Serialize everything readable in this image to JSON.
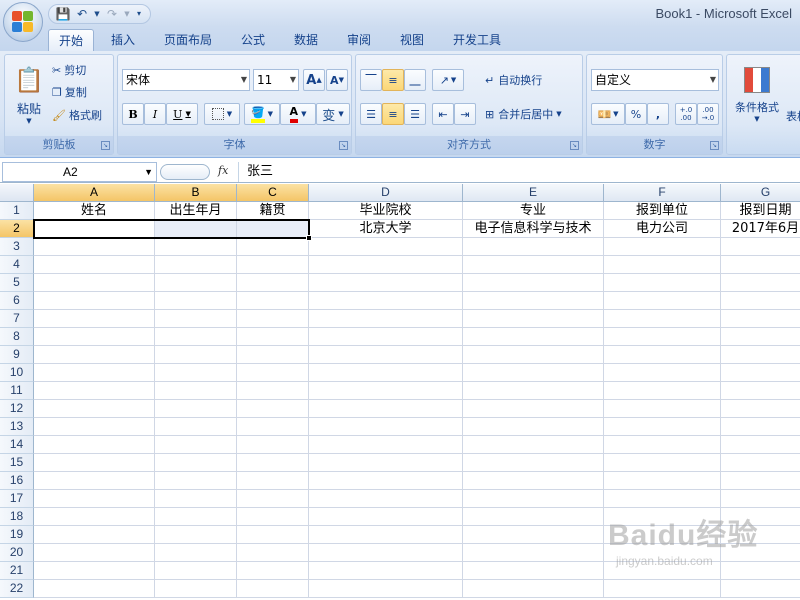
{
  "window": {
    "title": "Book1 - Microsoft Excel"
  },
  "tabs": [
    "开始",
    "插入",
    "页面布局",
    "公式",
    "数据",
    "审阅",
    "视图",
    "开发工具"
  ],
  "ribbon": {
    "clipboard": {
      "label": "剪贴板",
      "paste": "粘贴",
      "cut": "剪切",
      "copy": "复制",
      "format_painter": "格式刷"
    },
    "font": {
      "label": "字体",
      "name": "宋体",
      "size": "11",
      "bold": "B",
      "italic": "I",
      "underline": "U",
      "grow": "A",
      "shrink": "A",
      "color_glyph": "A",
      "wen": "变"
    },
    "alignment": {
      "label": "对齐方式",
      "wrap": "自动换行",
      "merge": "合并后居中"
    },
    "number": {
      "label": "数字",
      "format": "自定义",
      "percent": "%",
      "comma": ",",
      "inc_decimal": "+.0 .00",
      "dec_decimal": ".00 →.0"
    },
    "styles": {
      "conditional": "条件格式",
      "table_partial": "表格"
    }
  },
  "formula_bar": {
    "name_box": "A2",
    "fx": "fx",
    "value": "张三"
  },
  "sheet": {
    "columns": [
      "A",
      "B",
      "C",
      "D",
      "E",
      "F",
      "G"
    ],
    "rows": [
      "1",
      "2",
      "3",
      "4",
      "5",
      "6",
      "7",
      "8",
      "9",
      "10",
      "11",
      "12",
      "13",
      "14",
      "15",
      "16",
      "17",
      "18",
      "19",
      "20",
      "21",
      "22"
    ],
    "header_row": [
      "姓名",
      "出生年月",
      "籍贯",
      "毕业院校",
      "专业",
      "报到单位",
      "报到日期"
    ],
    "row2": [
      "",
      "",
      "",
      "北京大学",
      "电子信息科学与技术",
      "电力公司",
      "2017年6月"
    ],
    "active_cell": "A2",
    "selected_columns": [
      "A",
      "B",
      "C"
    ],
    "selected_row": "2"
  },
  "watermark": {
    "brand": "Baidu经验",
    "url": "jingyan.baidu.com"
  },
  "colors": {
    "ribbon": "#dbe6f4",
    "selection": "#f7c96a",
    "grid": "#d0d7e5",
    "header": "#e4ecf6"
  }
}
